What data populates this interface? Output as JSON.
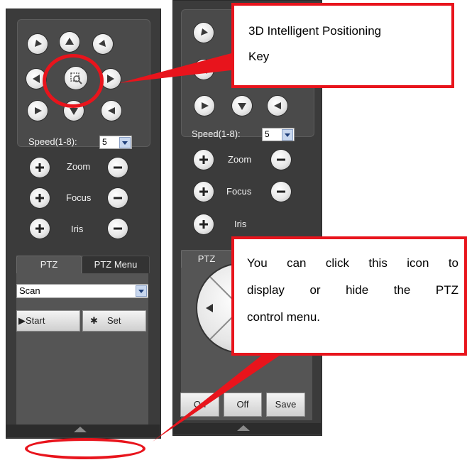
{
  "left_panel": {
    "speed_label": "Speed(1-8):",
    "speed_value": "5",
    "zoom_label": "Zoom",
    "focus_label": "Focus",
    "iris_label": "Iris",
    "tabs": [
      {
        "label": "PTZ"
      },
      {
        "label": "PTZ Menu"
      }
    ],
    "function_select": "Scan",
    "start_label": "▶Start",
    "set_label": "Set"
  },
  "right_panel": {
    "speed_label": "Speed(1-8):",
    "speed_value": "5",
    "zoom_label": "Zoom",
    "focus_label": "Focus",
    "iris_label": "Iris",
    "tab_label": "PTZ",
    "on_label": "On",
    "off_label": "Off",
    "save_label": "Save"
  },
  "callouts": {
    "positioning_line1": "3D Intelligent Positioning",
    "positioning_line2": "Key",
    "menu_line1": "You can click this icon to",
    "menu_line2": "display or hide the PTZ",
    "menu_line3": "control menu."
  },
  "colors": {
    "panel": "#3b3b3b",
    "annotation": "#e8141c"
  }
}
